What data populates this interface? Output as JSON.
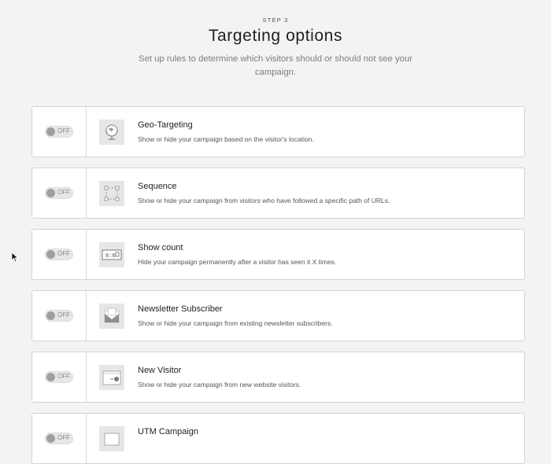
{
  "header": {
    "step": "STEP 3",
    "title": "Targeting options",
    "subtitle": "Set up rules to determine which visitors should or should not see your campaign."
  },
  "options": [
    {
      "title": "Geo-Targeting",
      "description": "Show or hide your campaign based on the visitor's location.",
      "toggle": "OFF",
      "icon": "globe-icon"
    },
    {
      "title": "Sequence",
      "description": "Show or hide your campaign from visitors who have followed a specific path of URLs.",
      "toggle": "OFF",
      "icon": "sequence-icon"
    },
    {
      "title": "Show count",
      "description": "Hide your campaign permanently after a visitor has seen it X times.",
      "toggle": "OFF",
      "icon": "counter-icon"
    },
    {
      "title": "Newsletter Subscriber",
      "description": "Show or hide your campaign from existing newsletter subscribers.",
      "toggle": "OFF",
      "icon": "envelope-icon"
    },
    {
      "title": "New Visitor",
      "description": "Show or hide your campaign from new website visitors.",
      "toggle": "OFF",
      "icon": "new-visitor-icon"
    },
    {
      "title": "UTM Campaign",
      "description": "",
      "toggle": "OFF",
      "icon": "utm-icon"
    }
  ],
  "counter_icon_text": "8:6",
  "colors": {
    "background": "#f3f3f3",
    "card": "#ffffff",
    "border": "#d4d4d4",
    "toggle_off": "#9f9f9f"
  }
}
